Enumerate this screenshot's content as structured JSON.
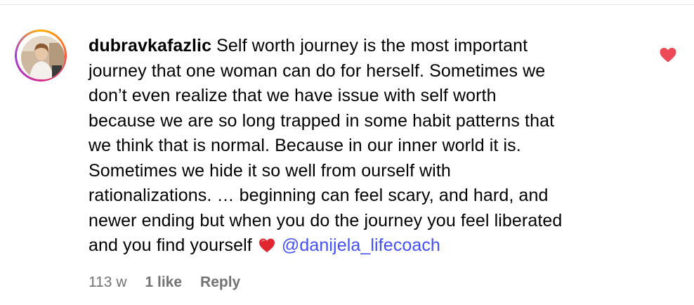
{
  "comment": {
    "username": "dubravkafazlic",
    "lines": [
      "Self worth journey is the most important",
      "journey that one woman can do for herself. Sometimes we",
      "don’t even realize that we have issue with self worth",
      "because we are so long trapped in some habit patterns that",
      "we think that is normal. Because in our inner world it is.",
      "Sometimes we hide it so well from ourself with",
      "rationalizations. … beginning can feel scary, and hard, and",
      "newer ending but when you do the journey you feel liberated",
      "and you find yourself"
    ],
    "emoji": "red-heart-emoji",
    "mention": "@danijela_lifecoach",
    "liked": true,
    "like_icon": "heart-icon"
  },
  "meta": {
    "time": "113 w",
    "likes": "1 like",
    "reply_label": "Reply"
  },
  "colors": {
    "mention": "#4150f7",
    "like_heart": "#ed4956",
    "meta_text": "#737373",
    "ring_gradient": [
      "#ffb000",
      "#ff5a3c",
      "#d62a8f",
      "#a23be0"
    ]
  }
}
